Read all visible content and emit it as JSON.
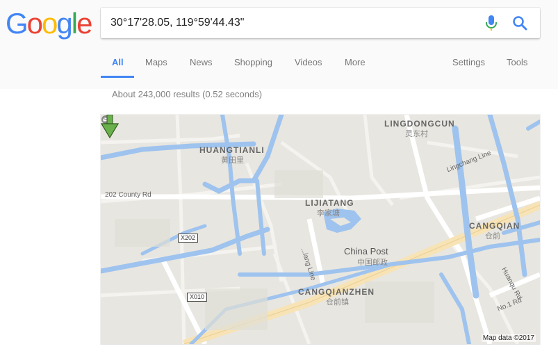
{
  "logo": {
    "letters": [
      "G",
      "o",
      "o",
      "g",
      "l",
      "e"
    ],
    "colors": [
      "#4285f4",
      "#ea4335",
      "#fbbc05",
      "#4285f4",
      "#34a853",
      "#ea4335"
    ]
  },
  "search": {
    "query": "30°17'28.05, 119°59'44.43\"",
    "mic_icon": "microphone-icon",
    "search_icon": "magnifier-icon"
  },
  "tabs": {
    "all": "All",
    "maps": "Maps",
    "news": "News",
    "shopping": "Shopping",
    "videos": "Videos",
    "more": "More",
    "settings": "Settings",
    "tools": "Tools",
    "active_color": "#4285f4"
  },
  "results": {
    "count_text": "About 243,000 results (0.52 seconds)"
  },
  "map": {
    "places": {
      "lingdongcun": "LINGDONGCUN",
      "lingdongcun_cn": "灵东村",
      "huangtianli": "HUANGTIANLI",
      "huangtianli_cn": "黄田里",
      "lijiatang": "LIJIATANG",
      "lijiatang_cn": "李家塘",
      "cangqian": "CANGQIAN",
      "cangqian_cn": "仓前",
      "cangqianzhen": "CANGQIANZHEN",
      "cangqianzhen_cn": "仓前镇",
      "china_post": "China Post",
      "china_post_cn": "中国邮政"
    },
    "roads": {
      "county_rd": "202 County Rd",
      "lingchang_line": "Lingchang Line",
      "liang_line": "...iang Line",
      "huangqu_rd": "Huanqu Rd",
      "no1_rd": "No.1 Rd",
      "x202": "X202",
      "x010": "X010"
    },
    "credit": "Map data ©2017",
    "colors": {
      "land": "#e8e6e0",
      "water": "#9ec3ee",
      "road": "#ffffff",
      "highway": "#f7e3b5",
      "pin": "#6ab04c"
    }
  }
}
